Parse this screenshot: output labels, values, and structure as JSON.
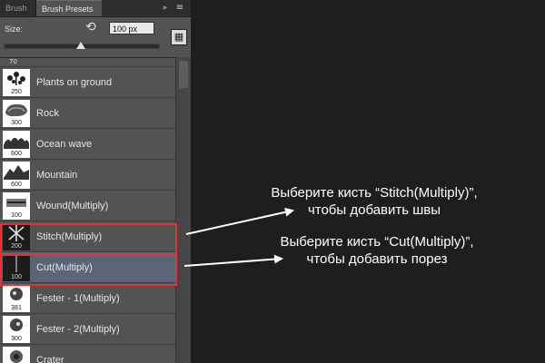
{
  "tabs": {
    "brush": "Brush",
    "presets": "Brush Presets",
    "menu_icon": "»",
    "options_icon": "≡"
  },
  "options": {
    "size_label": "Size:",
    "size_value": "100 px",
    "reset_icon": "⟲",
    "stamp_icon": "▦"
  },
  "first_row_num": "70",
  "brushes": [
    {
      "num": "250",
      "label": "Plants on ground",
      "icon": "plants-brush-icon"
    },
    {
      "num": "300",
      "label": "Rock",
      "icon": "rock-brush-icon"
    },
    {
      "num": "600",
      "label": "Ocean wave",
      "icon": "ocean-wave-brush-icon"
    },
    {
      "num": "600",
      "label": "Mountain",
      "icon": "mountain-brush-icon"
    },
    {
      "num": "100",
      "label": "Wound(Multiply)",
      "icon": "wound-brush-icon"
    },
    {
      "num": "200",
      "label": "Stitch(Multiply)",
      "icon": "stitch-brush-icon"
    },
    {
      "num": "100",
      "label": "Cut(Multiply)",
      "icon": "cut-brush-icon",
      "selected": true
    },
    {
      "num": "381",
      "label": "Fester - 1(Multiply)",
      "icon": "fester1-brush-icon"
    },
    {
      "num": "300",
      "label": "Fester - 2(Multiply)",
      "icon": "fester2-brush-icon"
    },
    {
      "num": "",
      "label": "Crater",
      "icon": "crater-brush-icon"
    }
  ],
  "callouts": {
    "stitch_line1": "Выберите кисть “Stitch(Multiply)”,",
    "stitch_line2": "чтобы добавить швы",
    "cut_line1": "Выберите кисть “Cut(Multiply)”,",
    "cut_line2": "чтобы добавить порез"
  },
  "colors": {
    "highlight": "#e0342f",
    "selected_row": "#5c6477",
    "panel": "#535353",
    "background": "#1e1e1e"
  }
}
